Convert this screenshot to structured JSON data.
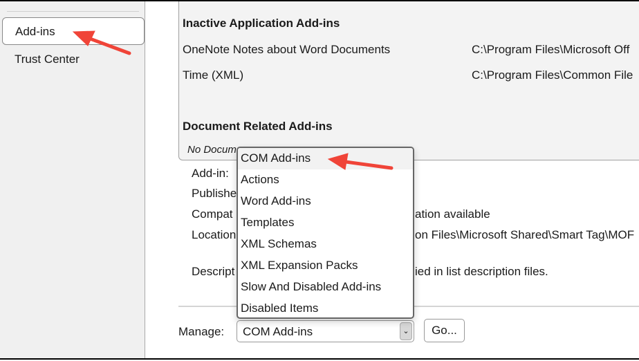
{
  "sidebar": {
    "items": [
      {
        "label": "Add-ins",
        "selected": true
      },
      {
        "label": "Trust Center"
      }
    ]
  },
  "list": {
    "inactive_header": "Inactive Application Add-ins",
    "inactive": [
      {
        "name": "OneNote Notes about Word Documents",
        "location": "C:\\Program Files\\Microsoft Off"
      },
      {
        "name": "Time (XML)",
        "location": "C:\\Program Files\\Common File"
      }
    ],
    "document_header": "Document Related Add-ins",
    "document_empty": "No Docum"
  },
  "details": {
    "addin_label": "Add-in:",
    "publisher_label": "Publishe",
    "compat_label": "Compat",
    "compat_value": "ation available",
    "location_label": "Location",
    "location_value": "on Files\\Microsoft Shared\\Smart Tag\\MOF",
    "description_label": "Descript",
    "description_value": "ied in list description files."
  },
  "manage": {
    "label": "Manage:",
    "selected": "COM Add-ins",
    "go_label": "Go...",
    "options": [
      "COM Add-ins",
      "Actions",
      "Word Add-ins",
      "Templates",
      "XML Schemas",
      "XML Expansion Packs",
      "Slow And Disabled Add-ins",
      "Disabled Items"
    ]
  },
  "colors": {
    "annotation": "#f04438"
  }
}
